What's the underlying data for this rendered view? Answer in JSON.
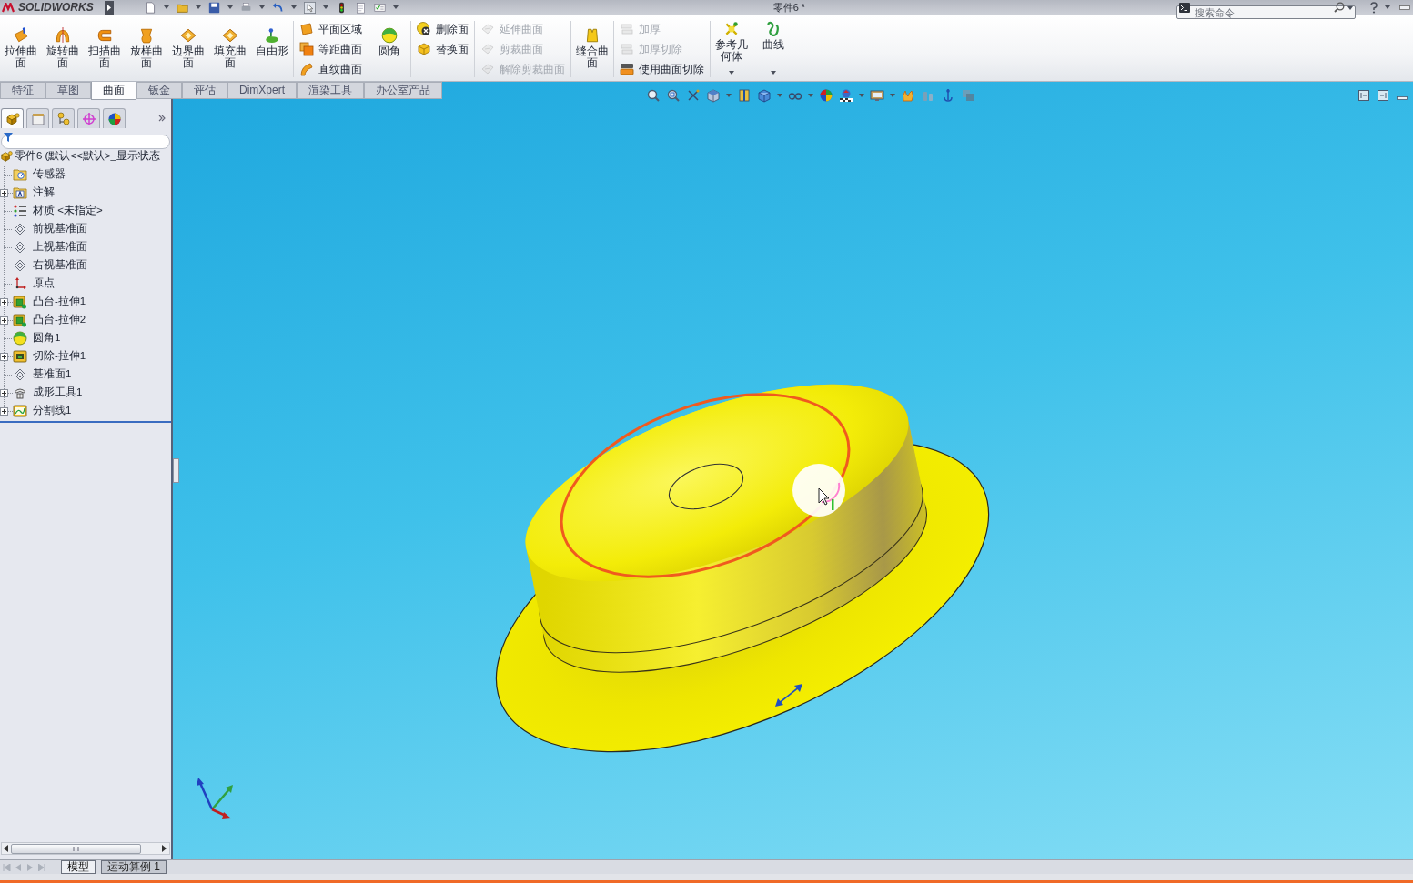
{
  "title_bar": {
    "app_name": "SOLIDWORKS",
    "title": "零件6 *",
    "search": {
      "placeholder": "搜索命令"
    }
  },
  "ribbon": {
    "groups": [
      {
        "kind": "large",
        "items": [
          {
            "label": "拉伸曲面",
            "disabled": false,
            "dropdown": false
          },
          {
            "label": "旋转曲面",
            "disabled": false,
            "dropdown": false
          },
          {
            "label": "扫描曲面",
            "disabled": false,
            "dropdown": false
          },
          {
            "label": "放样曲面",
            "disabled": false,
            "dropdown": false
          },
          {
            "label": "边界曲面",
            "disabled": false,
            "dropdown": false
          },
          {
            "label": "填充曲面",
            "disabled": false,
            "dropdown": false
          },
          {
            "label": "自由形",
            "disabled": false,
            "dropdown": false
          }
        ]
      },
      {
        "kind": "stack",
        "items": [
          {
            "label": "平面区域",
            "disabled": false
          },
          {
            "label": "等距曲面",
            "disabled": false
          },
          {
            "label": "直纹曲面",
            "disabled": false
          }
        ]
      },
      {
        "kind": "large",
        "items": [
          {
            "label": "圆角",
            "disabled": false,
            "dropdown": false
          }
        ]
      },
      {
        "kind": "stack",
        "items": [
          {
            "label": "删除面",
            "disabled": false
          },
          {
            "label": "替换面",
            "disabled": false
          }
        ]
      },
      {
        "kind": "stack",
        "items": [
          {
            "label": "延伸曲面",
            "disabled": true
          },
          {
            "label": "剪裁曲面",
            "disabled": true
          },
          {
            "label": "解除剪裁曲面",
            "disabled": true
          }
        ]
      },
      {
        "kind": "large",
        "items": [
          {
            "label": "缝合曲面",
            "disabled": false,
            "dropdown": false
          }
        ]
      },
      {
        "kind": "stack",
        "items": [
          {
            "label": "加厚",
            "disabled": true
          },
          {
            "label": "加厚切除",
            "disabled": true
          },
          {
            "label": "使用曲面切除",
            "disabled": false
          }
        ]
      },
      {
        "kind": "large",
        "items": [
          {
            "label": "参考几何体",
            "disabled": false,
            "dropdown": true
          },
          {
            "label": "曲线",
            "disabled": false,
            "dropdown": true
          }
        ]
      }
    ]
  },
  "tabs": [
    {
      "label": "特征",
      "selected": false
    },
    {
      "label": "草图",
      "selected": false
    },
    {
      "label": "曲面",
      "selected": true
    },
    {
      "label": "钣金",
      "selected": false
    },
    {
      "label": "评估",
      "selected": false
    },
    {
      "label": "DimXpert",
      "selected": false
    },
    {
      "label": "渲染工具",
      "selected": false
    },
    {
      "label": "办公室产品",
      "selected": false
    }
  ],
  "panel_tabs": [
    {
      "selected": true
    },
    {
      "selected": false
    },
    {
      "selected": false
    },
    {
      "selected": false
    },
    {
      "selected": false
    }
  ],
  "feature_tree": {
    "root": {
      "label": "零件6 (默认<<默认>_显示状态",
      "children": [
        {
          "label": "传感器",
          "kind": "sensors",
          "expandable": false
        },
        {
          "label": "注解",
          "kind": "annotations",
          "expandable": true
        },
        {
          "label": "材质 <未指定>",
          "kind": "material",
          "expandable": false
        },
        {
          "label": "前视基准面",
          "kind": "plane",
          "expandable": false
        },
        {
          "label": "上视基准面",
          "kind": "plane",
          "expandable": false
        },
        {
          "label": "右视基准面",
          "kind": "plane",
          "expandable": false
        },
        {
          "label": "原点",
          "kind": "origin",
          "expandable": false
        },
        {
          "label": "凸台-拉伸1",
          "kind": "boss",
          "expandable": true
        },
        {
          "label": "凸台-拉伸2",
          "kind": "boss",
          "expandable": true
        },
        {
          "label": "圆角1",
          "kind": "fillet",
          "expandable": false
        },
        {
          "label": "切除-拉伸1",
          "kind": "cut",
          "expandable": true
        },
        {
          "label": "基准面1",
          "kind": "plane",
          "expandable": false
        },
        {
          "label": "成形工具1",
          "kind": "tool",
          "expandable": true
        },
        {
          "label": "分割线1",
          "kind": "split",
          "expandable": true
        }
      ]
    }
  },
  "bottom_tabs": [
    {
      "label": "模型",
      "selected": true
    },
    {
      "label": "运动算例 1",
      "selected": false
    }
  ]
}
